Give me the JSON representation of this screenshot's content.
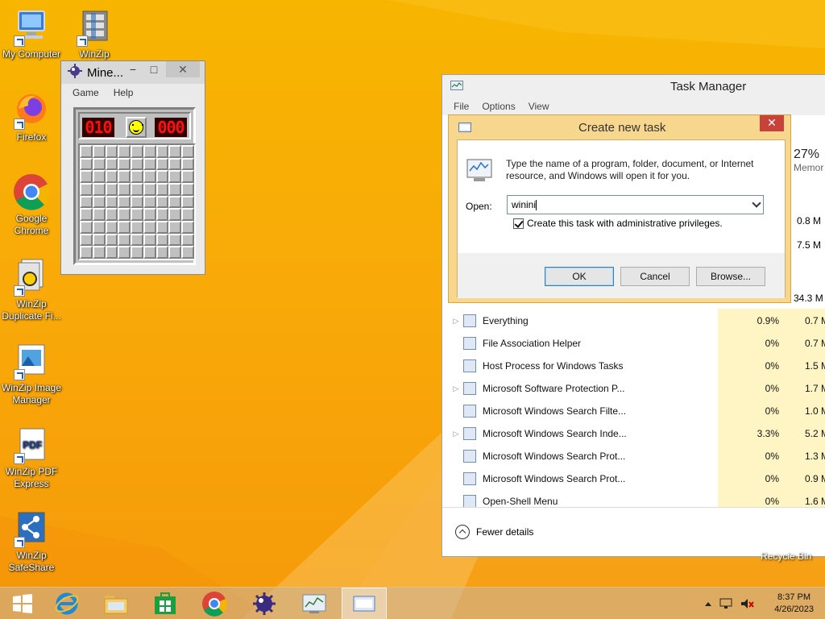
{
  "desktop": {
    "icons": [
      {
        "label": "My Computer"
      },
      {
        "label": "WinZip"
      },
      {
        "label": "Firefox"
      },
      {
        "label": "Google Chrome"
      },
      {
        "label": "WinZip Duplicate Fi..."
      },
      {
        "label": "WinZip Image Manager"
      },
      {
        "label": "WinZip PDF Express"
      },
      {
        "label": "WinZip SafeShare"
      }
    ],
    "recycle_bin_partial": "Recycle Bin"
  },
  "minesweeper": {
    "title": "Mine...",
    "minimize": "−",
    "maximize": "□",
    "close": "✕",
    "menu": {
      "game": "Game",
      "help": "Help"
    },
    "mines_counter": "010",
    "timer": "000"
  },
  "task_manager": {
    "title": "Task Manager",
    "menu": {
      "file": "File",
      "options": "Options",
      "view": "View"
    },
    "header": {
      "memory_pct": "27%",
      "memory_label": "Memor"
    },
    "partial_values": [
      "0.8 M",
      "7.5 M",
      "34.3 M"
    ],
    "processes": [
      {
        "name": "Everything",
        "cpu": "0.9%",
        "mem": "0.7 M",
        "expandable": true
      },
      {
        "name": "File Association Helper",
        "cpu": "0%",
        "mem": "0.7 M",
        "expandable": false
      },
      {
        "name": "Host Process for Windows Tasks",
        "cpu": "0%",
        "mem": "1.5 M",
        "expandable": false
      },
      {
        "name": "Microsoft Software Protection P...",
        "cpu": "0%",
        "mem": "1.7 M",
        "expandable": true
      },
      {
        "name": "Microsoft Windows Search Filte...",
        "cpu": "0%",
        "mem": "1.0 M",
        "expandable": false
      },
      {
        "name": "Microsoft Windows Search Inde...",
        "cpu": "3.3%",
        "mem": "5.2 M",
        "expandable": true
      },
      {
        "name": "Microsoft Windows Search Prot...",
        "cpu": "0%",
        "mem": "1.3 M",
        "expandable": false
      },
      {
        "name": "Microsoft Windows Search Prot...",
        "cpu": "0%",
        "mem": "0.9 M",
        "expandable": false
      },
      {
        "name": "Open-Shell Menu",
        "cpu": "0%",
        "mem": "1.6 M",
        "expandable": false
      }
    ],
    "fewer_details": "Fewer details"
  },
  "run_dialog": {
    "title": "Create new task",
    "close": "✕",
    "description": "Type the name of a program, folder, document, or Internet resource, and Windows will open it for you.",
    "open_label": "Open:",
    "open_value": "winini",
    "admin_checkbox_label": "Create this task with administrative privileges.",
    "admin_checked": true,
    "ok": "OK",
    "cancel": "Cancel",
    "browse": "Browse..."
  },
  "taskbar": {
    "time": "8:37 PM",
    "date": "4/26/2023"
  }
}
